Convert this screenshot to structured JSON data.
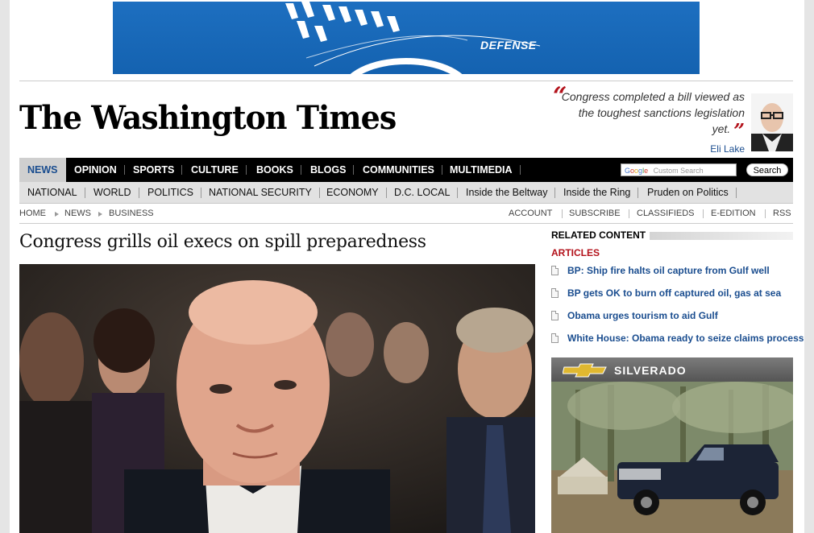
{
  "ad_banner": {
    "label": "DEFENSE"
  },
  "masthead": {
    "logo_text": "The Washington Times",
    "quote": "Congress completed a bill viewed as the toughest sanctions legislation yet.",
    "quote_author": "Eli Lake"
  },
  "main_nav": {
    "items": [
      "NEWS",
      "OPINION",
      "SPORTS",
      "CULTURE",
      "BOOKS",
      "BLOGS",
      "COMMUNITIES",
      "MULTIMEDIA"
    ],
    "search_placeholder": "Custom Search",
    "search_brand": "Google",
    "search_button": "Search"
  },
  "sub_nav": {
    "items": [
      "NATIONAL",
      "WORLD",
      "POLITICS",
      "NATIONAL SECURITY",
      "ECONOMY",
      "D.C. LOCAL",
      "Inside the Beltway",
      "Inside the Ring",
      "Pruden on Politics"
    ]
  },
  "breadcrumb": [
    "HOME",
    "NEWS",
    "BUSINESS"
  ],
  "utility_links": [
    "ACCOUNT",
    "SUBSCRIBE",
    "CLASSIFIEDS",
    "E-EDITION",
    "RSS"
  ],
  "article": {
    "headline": "Congress grills oil execs on spill preparedness"
  },
  "related": {
    "header": "RELATED CONTENT",
    "subheader": "ARTICLES",
    "articles": [
      "BP: Ship fire halts oil capture from Gulf well",
      "BP gets OK to burn off captured oil, gas at sea",
      "Obama urges tourism to aid Gulf",
      "White House: Obama ready to seize claims process"
    ]
  },
  "silverado_ad": {
    "title": "SILVERADO"
  },
  "colors": {
    "nav_bg": "#000000",
    "link_blue": "#1a4d8f",
    "accent_red": "#b3121b",
    "ad_blue": "#1462b0"
  }
}
